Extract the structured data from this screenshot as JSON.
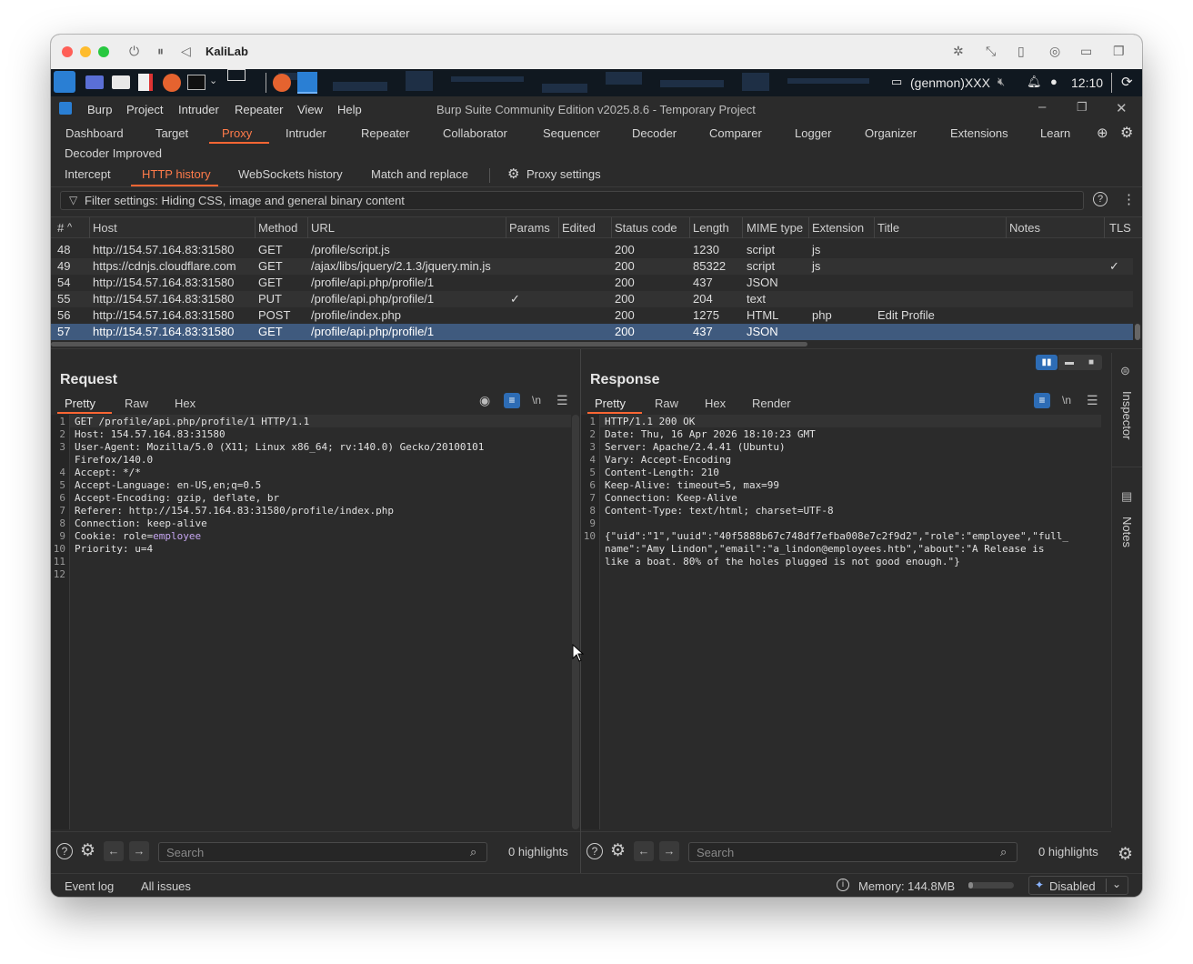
{
  "vm": {
    "title": "KaliLab"
  },
  "kali": {
    "status_user": "(genmon)XXX",
    "clock": "12:10"
  },
  "app": {
    "window_title": "Burp Suite Community Edition v2025.8.6 - Temporary Project",
    "menu": [
      "Burp",
      "Project",
      "Intruder",
      "Repeater",
      "View",
      "Help"
    ]
  },
  "main_tabs": [
    "Dashboard",
    "Target",
    "Proxy",
    "Intruder",
    "Repeater",
    "Collaborator",
    "Sequencer",
    "Decoder",
    "Comparer",
    "Logger",
    "Organizer",
    "Extensions",
    "Learn"
  ],
  "main_tabs_row2": "Decoder Improved",
  "proxy_tabs": [
    "Intercept",
    "HTTP history",
    "WebSockets history",
    "Match and replace"
  ],
  "proxy_settings": "Proxy settings",
  "filter": {
    "text": "Filter settings: Hiding CSS, image and general binary content"
  },
  "table": {
    "headers": [
      "#",
      "Host",
      "Method",
      "URL",
      "Params",
      "Edited",
      "Status code",
      "Length",
      "MIME type",
      "Extension",
      "Title",
      "Notes",
      "TLS"
    ],
    "rows": [
      {
        "num": "48",
        "host": "http://154.57.164.83:31580",
        "method": "GET",
        "url": "/profile/script.js",
        "params": "",
        "status": "200",
        "length": "1230",
        "mime": "script",
        "ext": "js",
        "title": "",
        "tls": ""
      },
      {
        "num": "49",
        "host": "https://cdnjs.cloudflare.com",
        "method": "GET",
        "url": "/ajax/libs/jquery/2.1.3/jquery.min.js",
        "params": "",
        "status": "200",
        "length": "85322",
        "mime": "script",
        "ext": "js",
        "title": "",
        "tls": "✓"
      },
      {
        "num": "54",
        "host": "http://154.57.164.83:31580",
        "method": "GET",
        "url": "/profile/api.php/profile/1",
        "params": "",
        "status": "200",
        "length": "437",
        "mime": "JSON",
        "ext": "",
        "title": "",
        "tls": ""
      },
      {
        "num": "55",
        "host": "http://154.57.164.83:31580",
        "method": "PUT",
        "url": "/profile/api.php/profile/1",
        "params": "✓",
        "status": "200",
        "length": "204",
        "mime": "text",
        "ext": "",
        "title": "",
        "tls": ""
      },
      {
        "num": "56",
        "host": "http://154.57.164.83:31580",
        "method": "POST",
        "url": "/profile/index.php",
        "params": "",
        "status": "200",
        "length": "1275",
        "mime": "HTML",
        "ext": "php",
        "title": "Edit Profile",
        "tls": ""
      },
      {
        "num": "57",
        "host": "http://154.57.164.83:31580",
        "method": "GET",
        "url": "/profile/api.php/profile/1",
        "params": "",
        "status": "200",
        "length": "437",
        "mime": "JSON",
        "ext": "",
        "title": "",
        "tls": ""
      }
    ]
  },
  "request": {
    "title": "Request",
    "tabs": [
      "Pretty",
      "Raw",
      "Hex"
    ],
    "lines": [
      {
        "n": "1",
        "text": "GET /profile/api.php/profile/1 HTTP/1.1"
      },
      {
        "n": "2",
        "text": "Host: 154.57.164.83:31580"
      },
      {
        "n": "3",
        "text": "User-Agent: Mozilla/5.0 (X11; Linux x86_64; rv:140.0) Gecko/20100101"
      },
      {
        "n": "",
        "text": "Firefox/140.0"
      },
      {
        "n": "4",
        "text": "Accept: */*"
      },
      {
        "n": "5",
        "text": "Accept-Language: en-US,en;q=0.5"
      },
      {
        "n": "6",
        "text": "Accept-Encoding: gzip, deflate, br"
      },
      {
        "n": "7",
        "text": "Referer: http://154.57.164.83:31580/profile/index.php"
      },
      {
        "n": "8",
        "text": "Connection: keep-alive"
      },
      {
        "n": "9",
        "text": "Cookie: role=",
        "extra": "employee"
      },
      {
        "n": "10",
        "text": "Priority: u=4"
      },
      {
        "n": "11",
        "text": ""
      },
      {
        "n": "12",
        "text": ""
      }
    ],
    "search_placeholder": "Search",
    "highlights": "0 highlights"
  },
  "response": {
    "title": "Response",
    "tabs": [
      "Pretty",
      "Raw",
      "Hex",
      "Render"
    ],
    "lines": [
      {
        "n": "1",
        "text": "HTTP/1.1 200 OK"
      },
      {
        "n": "2",
        "text": "Date: Thu, 16 Apr 2026 18:10:23 GMT"
      },
      {
        "n": "3",
        "text": "Server: Apache/2.4.41 (Ubuntu)"
      },
      {
        "n": "4",
        "text": "Vary: Accept-Encoding"
      },
      {
        "n": "5",
        "text": "Content-Length: 210"
      },
      {
        "n": "6",
        "text": "Keep-Alive: timeout=5, max=99"
      },
      {
        "n": "7",
        "text": "Connection: Keep-Alive"
      },
      {
        "n": "8",
        "text": "Content-Type: text/html; charset=UTF-8"
      },
      {
        "n": "9",
        "text": ""
      },
      {
        "n": "10",
        "text": "{\"uid\":\"1\",\"uuid\":\"40f5888b67c748df7efba008e7c2f9d2\",\"role\":\"employee\",\"full_"
      },
      {
        "n": "",
        "text": "name\":\"Amy Lindon\",\"email\":\"a_lindon@employees.htb\",\"about\":\"A Release is"
      },
      {
        "n": "",
        "text": "like a boat. 80% of the holes plugged is not good enough.\"}"
      }
    ],
    "search_placeholder": "Search",
    "highlights": "0 highlights"
  },
  "side": {
    "inspector": "Inspector",
    "notes": "Notes"
  },
  "status": {
    "event_log": "Event log",
    "all_issues": "All issues",
    "memory": "Memory: 144.8MB",
    "ai": "Disabled"
  },
  "colors": {
    "accent": "#ff6633",
    "selected_row": "#3f5a7e",
    "cookie_value": "#c5a5f0"
  }
}
